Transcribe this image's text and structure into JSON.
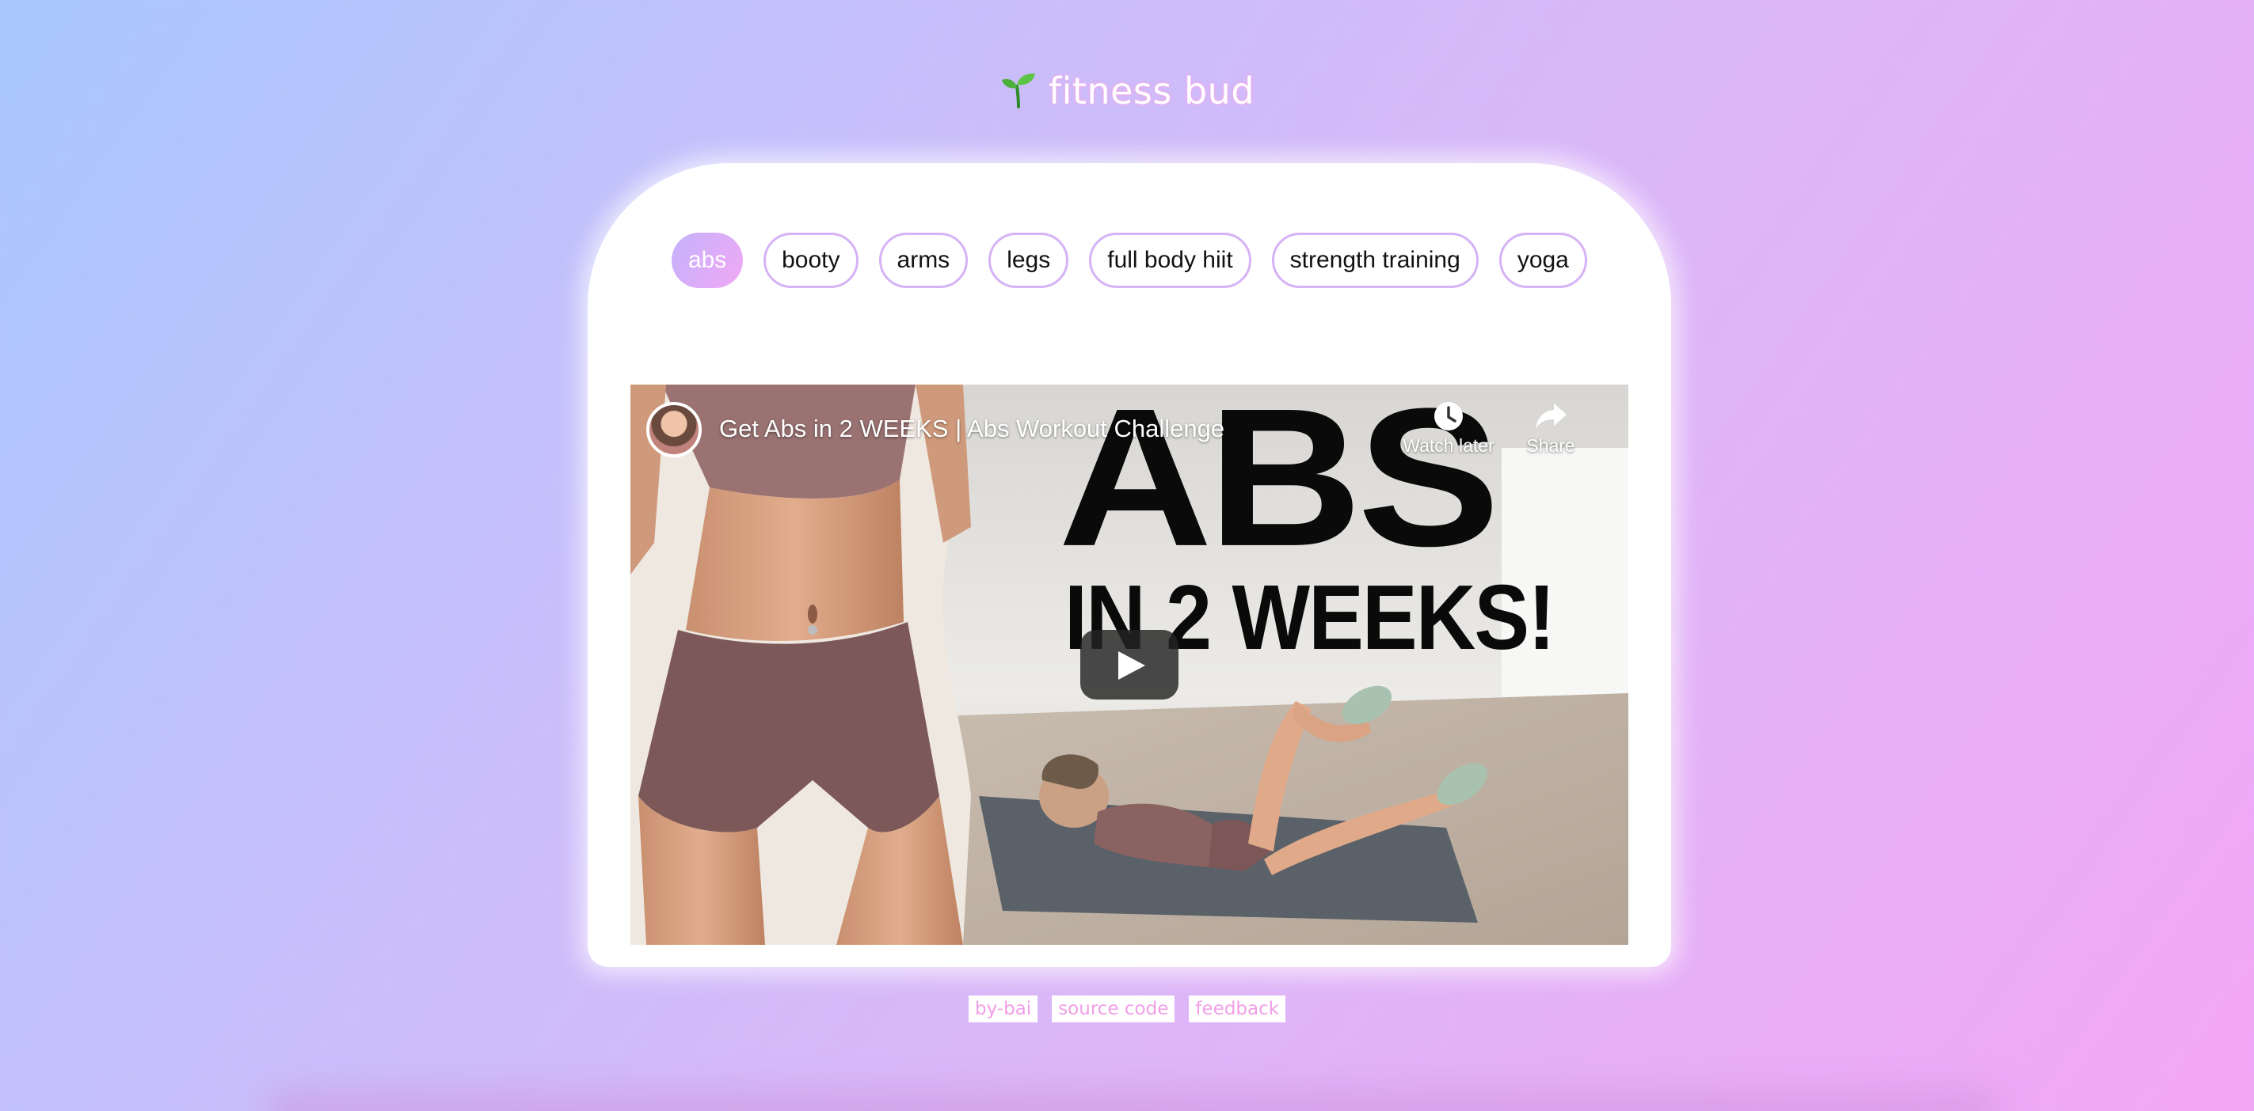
{
  "app": {
    "title": "fitness bud",
    "logo_icon": "sprout-icon"
  },
  "tabs": [
    {
      "label": "abs",
      "active": true
    },
    {
      "label": "booty",
      "active": false
    },
    {
      "label": "arms",
      "active": false
    },
    {
      "label": "legs",
      "active": false
    },
    {
      "label": "full body hiit",
      "active": false
    },
    {
      "label": "strength training",
      "active": false
    },
    {
      "label": "yoga",
      "active": false
    }
  ],
  "video": {
    "title": "Get Abs in 2 WEEKS | Abs Workout Challenge",
    "thumbnail_headline": "ABS",
    "thumbnail_subheadline": "IN 2 WEEKS!",
    "watch_later_label": "Watch later",
    "share_label": "Share",
    "watch_later_icon": "clock-icon",
    "share_icon": "share-arrow-icon",
    "play_icon": "play-icon"
  },
  "footer": {
    "links": [
      "by-bai",
      "source code",
      "feedback"
    ]
  },
  "colors": {
    "accent_gradient_start": "#c4b2fb",
    "accent_gradient_end": "#f1a8f5",
    "tab_border": "#d6b2f6",
    "footer_link": "#f09ee6",
    "background_start": "#a8c8fd",
    "background_end": "#f3a6f6"
  }
}
